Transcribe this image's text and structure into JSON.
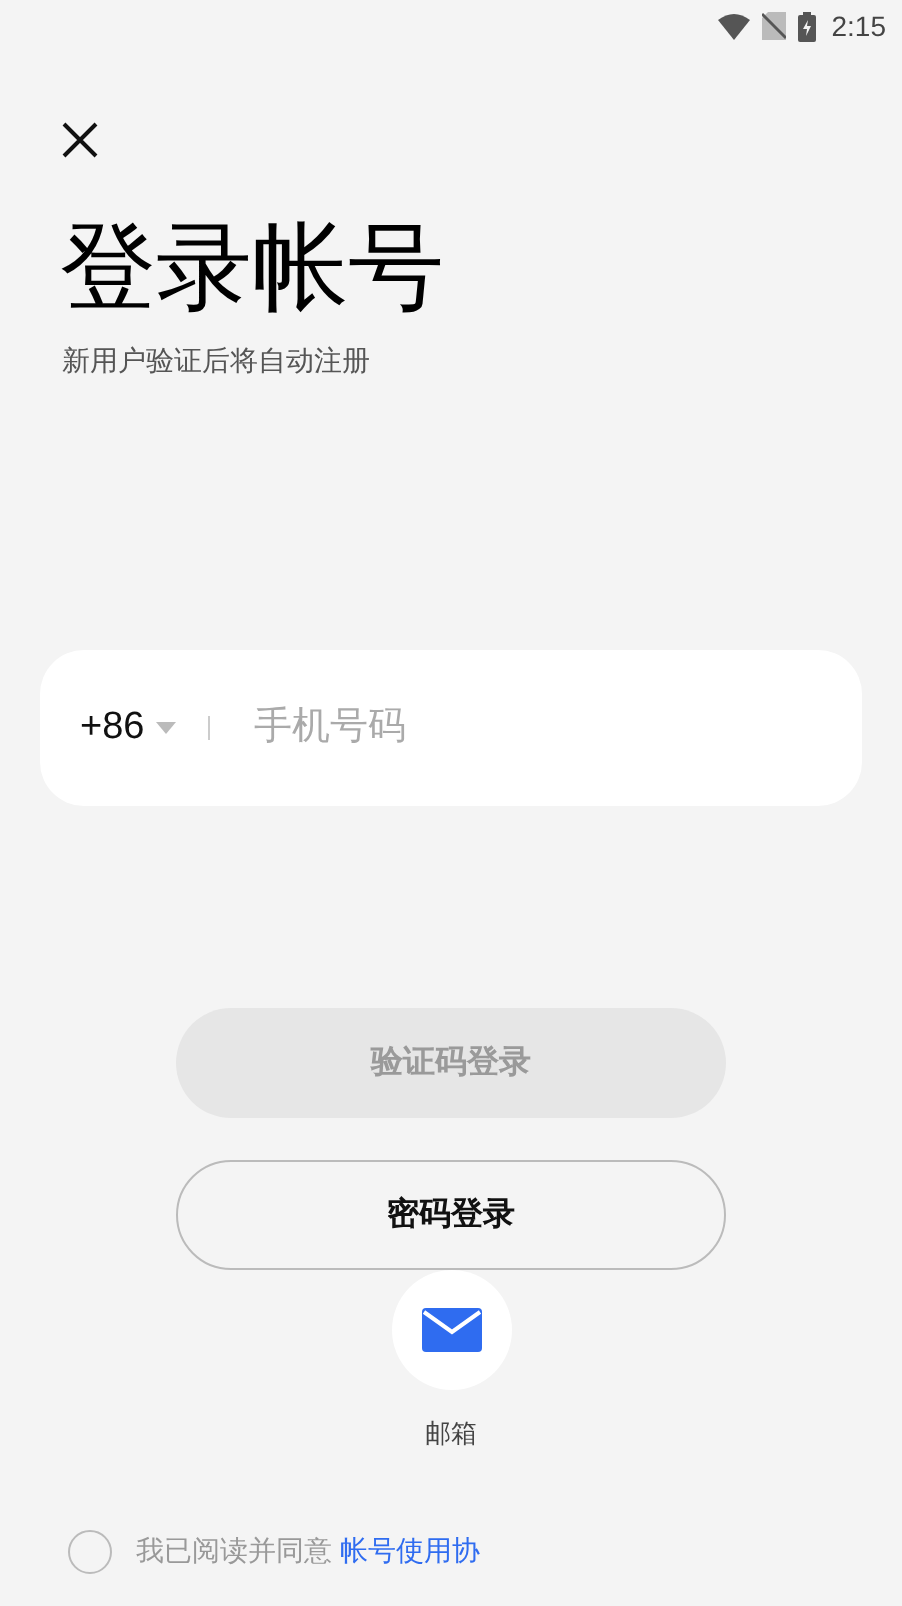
{
  "status_bar": {
    "time": "2:15"
  },
  "title": "登录帐号",
  "subtitle": "新用户验证后将自动注册",
  "phone_field": {
    "country_code": "+86",
    "placeholder": "手机号码"
  },
  "buttons": [
    {
      "label": "验证码登录",
      "disabled": true
    },
    {
      "label": "密码登录",
      "disabled": false
    }
  ],
  "alt_login": {
    "label": "邮箱"
  },
  "agreement": {
    "checked": false,
    "text": "我已阅读并同意",
    "link": "帐号使用协"
  }
}
